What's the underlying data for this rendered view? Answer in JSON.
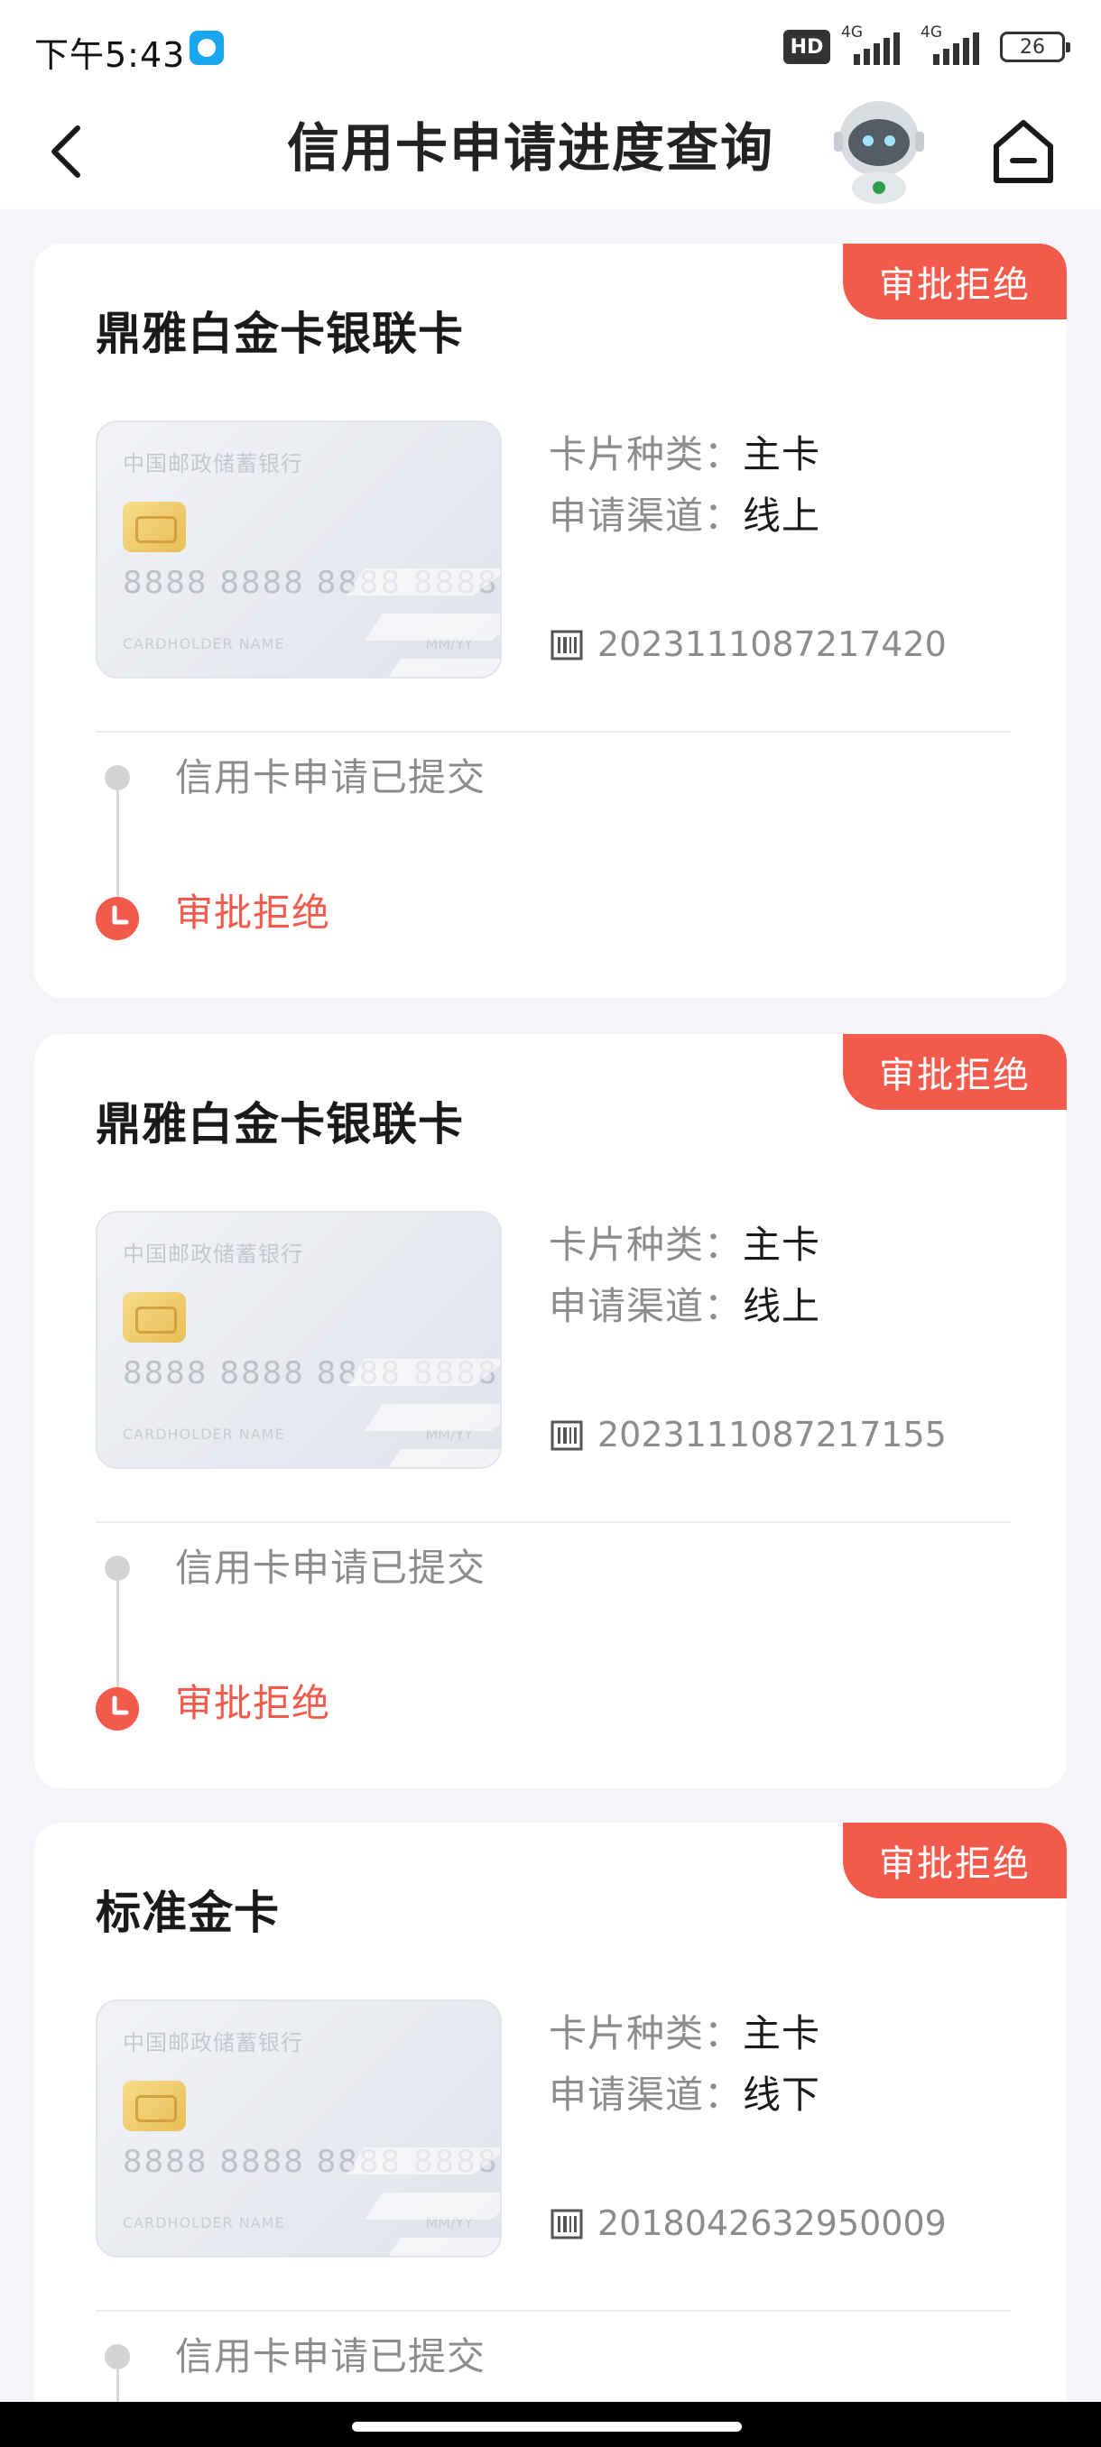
{
  "status_bar": {
    "time": "下午5:43",
    "hd": "HD",
    "signal_1": "4G",
    "signal_2": "4G",
    "battery": "26"
  },
  "header": {
    "title": "信用卡申请进度查询"
  },
  "applications": [
    {
      "status_badge": "审批拒绝",
      "card_name": "鼎雅白金卡银联卡",
      "card_type_label": "卡片种类：",
      "card_type_value": "主卡",
      "channel_label": "申请渠道：",
      "channel_value": "线上",
      "app_number": "2023111087217420",
      "steps": [
        "信用卡申请已提交",
        "审批拒绝"
      ]
    },
    {
      "status_badge": "审批拒绝",
      "card_name": "鼎雅白金卡银联卡",
      "card_type_label": "卡片种类：",
      "card_type_value": "主卡",
      "channel_label": "申请渠道：",
      "channel_value": "线上",
      "app_number": "2023111087217155",
      "steps": [
        "信用卡申请已提交",
        "审批拒绝"
      ]
    },
    {
      "status_badge": "审批拒绝",
      "card_name": "标准金卡",
      "card_type_label": "卡片种类：",
      "card_type_value": "主卡",
      "channel_label": "申请渠道：",
      "channel_value": "线下",
      "app_number": "2018042632950009",
      "steps": [
        "信用卡申请已提交"
      ]
    }
  ],
  "card_image": {
    "bank": "中国邮政储蓄银行",
    "number": "8888 8888 8888 8888",
    "holder": "CARDHOLDER NAME",
    "expiry": "MM/YY"
  },
  "colors": {
    "accent": "#f25a4b",
    "background": "#f4f4f9"
  }
}
